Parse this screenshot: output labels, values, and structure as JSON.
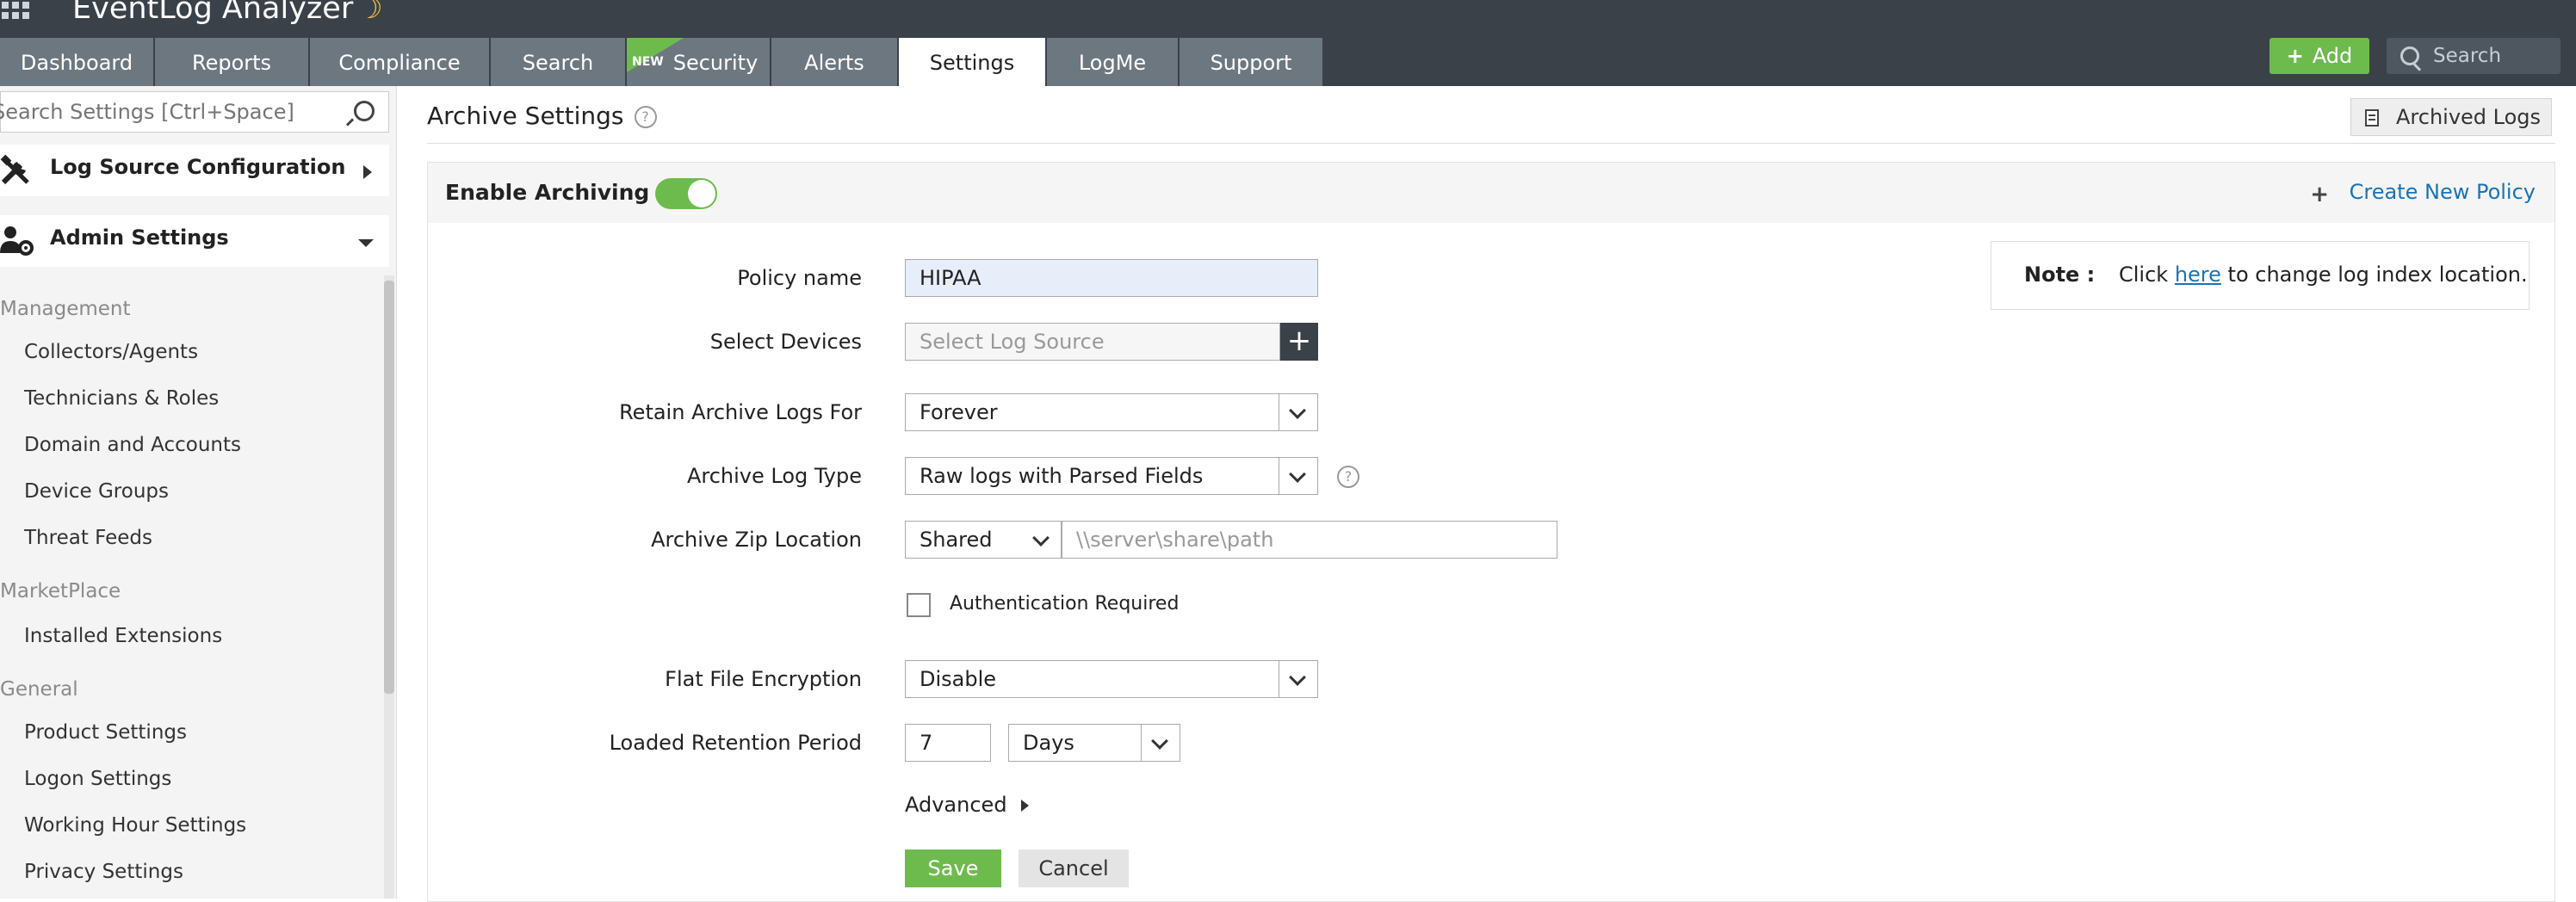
{
  "app": {
    "title": "EventLog Analyzer"
  },
  "nav": {
    "tabs": [
      {
        "label": "Dashboard"
      },
      {
        "label": "Reports"
      },
      {
        "label": "Compliance"
      },
      {
        "label": "Search"
      },
      {
        "label": "Security",
        "badge": "NEW"
      },
      {
        "label": "Alerts"
      },
      {
        "label": "Settings",
        "active": true
      },
      {
        "label": "LogMe"
      },
      {
        "label": "Support"
      }
    ],
    "add_label": "Add",
    "search_placeholder": "Search"
  },
  "sidebar": {
    "search_placeholder": "Search Settings [Ctrl+Space]",
    "sections": [
      {
        "label": "Log Source Configuration",
        "expanded": false
      },
      {
        "label": "Admin Settings",
        "expanded": true
      }
    ],
    "groups": [
      {
        "label": "Management",
        "items": [
          "Collectors/Agents",
          "Technicians & Roles",
          "Domain and Accounts",
          "Device Groups",
          "Threat Feeds"
        ]
      },
      {
        "label": "MarketPlace",
        "items": [
          "Installed Extensions"
        ]
      },
      {
        "label": "General",
        "items": [
          "Product Settings",
          "Logon Settings",
          "Working Hour Settings",
          "Privacy Settings"
        ]
      }
    ]
  },
  "main": {
    "title": "Archive Settings",
    "archived_logs_label": "Archived Logs",
    "enable_archiving_label": "Enable Archiving",
    "enable_archiving_on": true,
    "create_policy_label": "Create New Policy",
    "note": {
      "label": "Note :",
      "prefix": "Click ",
      "link": "here",
      "suffix": " to change log index location."
    },
    "form": {
      "policy_name_label": "Policy name",
      "policy_name_value": "HIPAA",
      "select_devices_label": "Select Devices",
      "select_devices_placeholder": "Select Log Source",
      "retain_label": "Retain Archive Logs For",
      "retain_value": "Forever",
      "log_type_label": "Archive Log Type",
      "log_type_value": "Raw logs with Parsed Fields",
      "zip_location_label": "Archive Zip Location",
      "zip_location_type": "Shared",
      "zip_location_placeholder": "\\\\server\\share\\path",
      "auth_required_label": "Authentication Required",
      "auth_required_checked": false,
      "encryption_label": "Flat File Encryption",
      "encryption_value": "Disable",
      "loaded_retention_label": "Loaded Retention Period",
      "loaded_retention_value": "7",
      "loaded_retention_unit": "Days",
      "advanced_label": "Advanced",
      "save_label": "Save",
      "cancel_label": "Cancel"
    }
  },
  "colors": {
    "header": "#3a4149",
    "tab": "#6d7780",
    "accent_green": "#6dbb4d",
    "link": "#1a73b5"
  }
}
